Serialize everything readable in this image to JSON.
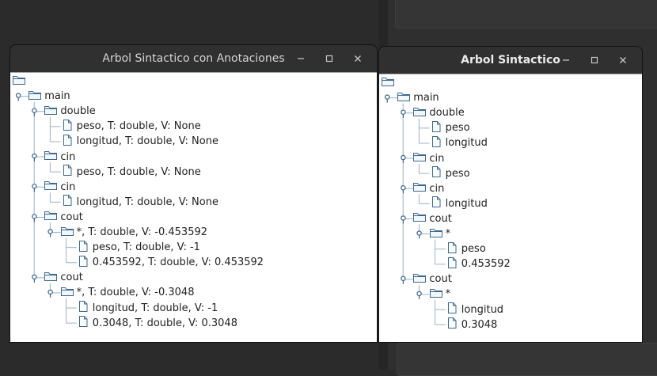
{
  "left_window": {
    "title": "Arbol Sintactico con Anotaciones",
    "tree": [
      {
        "label": "",
        "icon": "folder-icon",
        "depth": 0
      },
      {
        "label": "main",
        "icon": "folder-icon",
        "depth": 1,
        "expanded": true
      },
      {
        "label": "double",
        "icon": "folder-icon",
        "depth": 2,
        "expanded": true
      },
      {
        "label": "peso, T: double, V: None",
        "icon": "file-icon",
        "depth": 3
      },
      {
        "label": "longitud, T: double, V: None",
        "icon": "file-icon",
        "depth": 3
      },
      {
        "label": "cin",
        "icon": "folder-icon",
        "depth": 2,
        "expanded": true
      },
      {
        "label": "peso, T: double, V: None",
        "icon": "file-icon",
        "depth": 3
      },
      {
        "label": "cin",
        "icon": "folder-icon",
        "depth": 2,
        "expanded": true
      },
      {
        "label": "longitud, T: double, V: None",
        "icon": "file-icon",
        "depth": 3
      },
      {
        "label": "cout",
        "icon": "folder-icon",
        "depth": 2,
        "expanded": true
      },
      {
        "label": "*, T: double, V: -0.453592",
        "icon": "folder-icon",
        "depth": 3,
        "expanded": true
      },
      {
        "label": "peso, T: double, V: -1",
        "icon": "file-icon",
        "depth": 4
      },
      {
        "label": "0.453592, T: double, V: 0.453592",
        "icon": "file-icon",
        "depth": 4
      },
      {
        "label": "cout",
        "icon": "folder-icon",
        "depth": 2,
        "expanded": true
      },
      {
        "label": "*, T: double, V: -0.3048",
        "icon": "folder-icon",
        "depth": 3,
        "expanded": true
      },
      {
        "label": "longitud, T: double, V: -1",
        "icon": "file-icon",
        "depth": 4
      },
      {
        "label": "0.3048, T: double, V: 0.3048",
        "icon": "file-icon",
        "depth": 4
      }
    ]
  },
  "right_window": {
    "title": "Arbol Sintactico",
    "tree": [
      {
        "label": "",
        "icon": "folder-icon",
        "depth": 0
      },
      {
        "label": "main",
        "icon": "folder-icon",
        "depth": 1,
        "expanded": true
      },
      {
        "label": "double",
        "icon": "folder-icon",
        "depth": 2,
        "expanded": true
      },
      {
        "label": "peso",
        "icon": "file-icon",
        "depth": 3
      },
      {
        "label": "longitud",
        "icon": "file-icon",
        "depth": 3
      },
      {
        "label": "cin",
        "icon": "folder-icon",
        "depth": 2,
        "expanded": true
      },
      {
        "label": "peso",
        "icon": "file-icon",
        "depth": 3
      },
      {
        "label": "cin",
        "icon": "folder-icon",
        "depth": 2,
        "expanded": true
      },
      {
        "label": "longitud",
        "icon": "file-icon",
        "depth": 3
      },
      {
        "label": "cout",
        "icon": "folder-icon",
        "depth": 2,
        "expanded": true
      },
      {
        "label": "*",
        "icon": "folder-icon",
        "depth": 3,
        "expanded": true
      },
      {
        "label": "peso",
        "icon": "file-icon",
        "depth": 4
      },
      {
        "label": "0.453592",
        "icon": "file-icon",
        "depth": 4
      },
      {
        "label": "cout",
        "icon": "folder-icon",
        "depth": 2,
        "expanded": true
      },
      {
        "label": "*",
        "icon": "folder-icon",
        "depth": 3,
        "expanded": true
      },
      {
        "label": "longitud",
        "icon": "file-icon",
        "depth": 4
      },
      {
        "label": "0.3048",
        "icon": "file-icon",
        "depth": 4
      }
    ]
  },
  "window_controls": {
    "minimize_icon": "minimize-icon",
    "maximize_icon": "maximize-icon",
    "close_icon": "close-icon"
  },
  "colors": {
    "desktop": "#2b2b2b",
    "titlebar": "#303030",
    "tree_bg": "#ffffff",
    "tree_line": "#9bb0c6",
    "icon_stroke": "#3a6a96"
  }
}
